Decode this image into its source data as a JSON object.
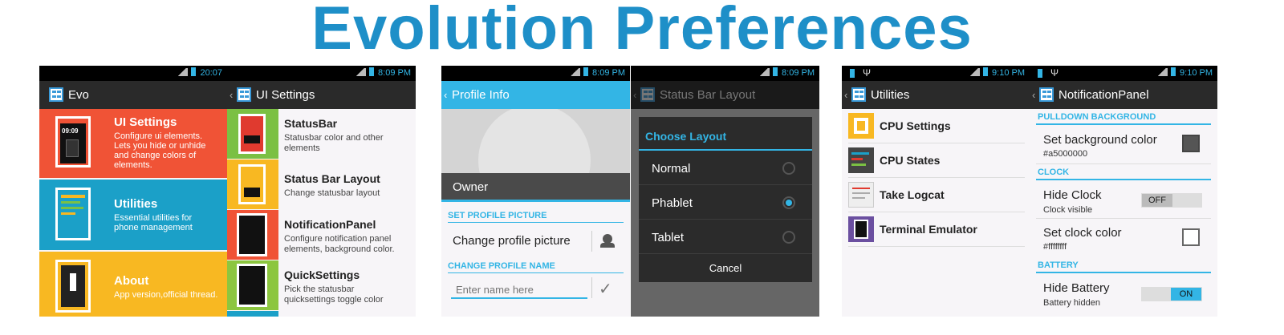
{
  "page_title": "Evolution Preferences",
  "colors": {
    "accent": "#33b5e5",
    "title": "#1e8fc8",
    "ui_red": "#f05336",
    "ui_blue": "#1ba0c8",
    "ui_yellow": "#f8b822"
  },
  "s1": {
    "time": "20:07",
    "app_title": "Evo",
    "tiles": [
      {
        "title": "UI Settings",
        "desc": "Configure ui elements. Lets you hide or unhide and change colors of elements.",
        "thumb_time": "09:09"
      },
      {
        "title": "Utilities",
        "desc": "Essential utilities for phone management"
      },
      {
        "title": "About",
        "desc": "App version,official thread."
      }
    ]
  },
  "s2": {
    "time": "8:09 PM",
    "app_title": "UI Settings",
    "items": [
      {
        "title": "StatusBar",
        "desc": "Statusbar color and other elements"
      },
      {
        "title": "Status Bar Layout",
        "desc": "Change statusbar layout"
      },
      {
        "title": "NotificationPanel",
        "desc": "Configure notification panel elements, background color."
      },
      {
        "title": "QuickSettings",
        "desc": "Pick the statusbar quicksettings toggle color"
      }
    ]
  },
  "s3": {
    "app_title": "Profile Info",
    "owner": "Owner",
    "sec1": "SET PROFILE PICTURE",
    "change_pic": "Change profile picture",
    "sec2": "CHANGE PROFILE NAME",
    "name_placeholder": "Enter name here"
  },
  "s4": {
    "time": "8:09 PM",
    "app_title": "Status Bar Layout",
    "dialog_title": "Choose Layout",
    "options": [
      "Normal",
      "Phablet",
      "Tablet"
    ],
    "selected": "Phablet",
    "cancel": "Cancel"
  },
  "s5": {
    "time": "9:10 PM",
    "app_title": "Utilities",
    "items": [
      "CPU Settings",
      "CPU States",
      "Take Logcat",
      "Terminal Emulator"
    ]
  },
  "s6": {
    "time": "9:10 PM",
    "app_title": "NotificationPanel",
    "sec_pulldown": "PULLDOWN BACKGROUND",
    "bg_title": "Set background color",
    "bg_value": "#a5000000",
    "sec_clock": "CLOCK",
    "hide_clock": "Hide Clock",
    "clock_visible": "Clock visible",
    "off": "OFF",
    "clock_color": "Set clock color",
    "clock_color_value": "#ffffffff",
    "sec_battery": "BATTERY",
    "hide_battery": "Hide Battery",
    "battery_hidden": "Battery hidden",
    "on": "ON"
  }
}
